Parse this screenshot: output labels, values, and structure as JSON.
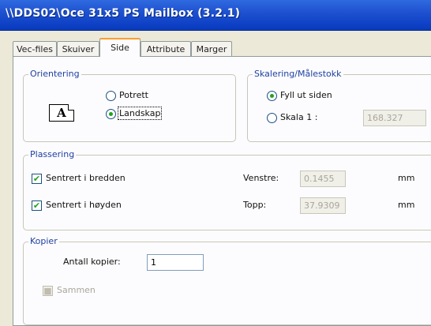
{
  "window": {
    "title": "\\\\DDS02\\Oce 31x5 PS Mailbox (3.2.1)"
  },
  "tabs": [
    "Vec-files",
    "Skuiver",
    "Side",
    "Attribute",
    "Marger"
  ],
  "orientation": {
    "legend": "Orientering",
    "icon_letter": "A",
    "portrait_label": "Potrett",
    "landscape_label": "Landskap",
    "selected": "landscape"
  },
  "scaling": {
    "legend": "Skalering/Målestokk",
    "fit_label": "Fyll ut siden",
    "scale_label": "Skala 1 :",
    "scale_value": "168.327",
    "selected": "fit"
  },
  "placement": {
    "legend": "Plassering",
    "center_width_label": "Sentrert i bredden",
    "center_width_checked": true,
    "center_height_label": "Sentrert i høyden",
    "center_height_checked": true,
    "left_label": "Venstre:",
    "left_value": "0.1455",
    "top_label": "Topp:",
    "top_value": "37.9309",
    "unit_1": "mm",
    "unit_2": "mm"
  },
  "copies": {
    "legend": "Kopier",
    "count_label": "Antall kopier:",
    "count_value": "1",
    "collate_label": "Sammen",
    "collate_checked": true
  },
  "colors": {
    "title_bar": "#0c3fc4",
    "tab_highlight": "#ff9b31",
    "radio_dot": "#21a121",
    "legend_text": "#1e3fa0"
  }
}
